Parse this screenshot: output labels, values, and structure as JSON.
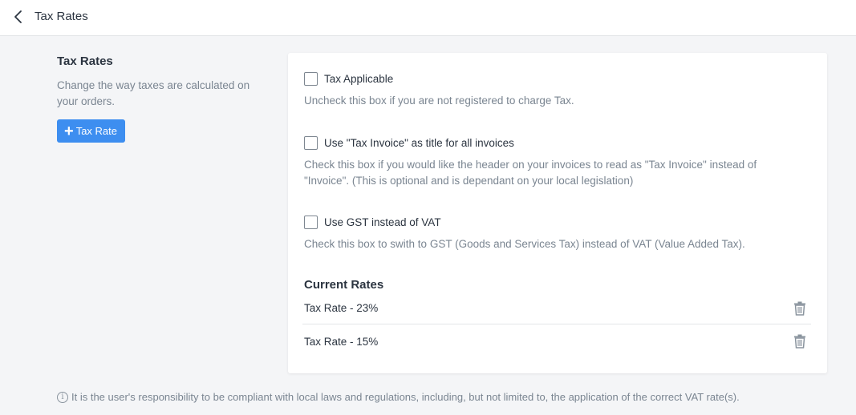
{
  "header": {
    "title": "Tax Rates",
    "back_icon": "chevron-left-icon"
  },
  "sidebar": {
    "title": "Tax Rates",
    "description": "Change the way taxes are calculated on your orders.",
    "add_button_label": "Tax Rate",
    "add_button_icon": "plus-icon",
    "accent_color": "#3d8ef0"
  },
  "options": [
    {
      "label": "Tax Applicable",
      "checked": false,
      "help": "Uncheck this box if you are not registered to charge Tax."
    },
    {
      "label": "Use \"Tax Invoice\" as title for all invoices",
      "checked": false,
      "help": "Check this box if you would like the header on your invoices to read as \"Tax Invoice\" instead of \"Invoice\". (This is optional and is dependant on your local legislation)"
    },
    {
      "label": "Use GST instead of VAT",
      "checked": false,
      "help": "Check this box to swith to GST (Goods and Services Tax) instead of VAT (Value Added Tax)."
    }
  ],
  "current_rates": {
    "title": "Current Rates",
    "items": [
      {
        "label": "Tax Rate - 23%",
        "delete_icon": "trash-icon"
      },
      {
        "label": "Tax Rate - 15%",
        "delete_icon": "trash-icon"
      }
    ]
  },
  "footnote": {
    "icon": "info-icon",
    "text": "It is the user's responsibility to be compliant with local laws and regulations, including, but not limited to, the application of the correct VAT rate(s)."
  }
}
